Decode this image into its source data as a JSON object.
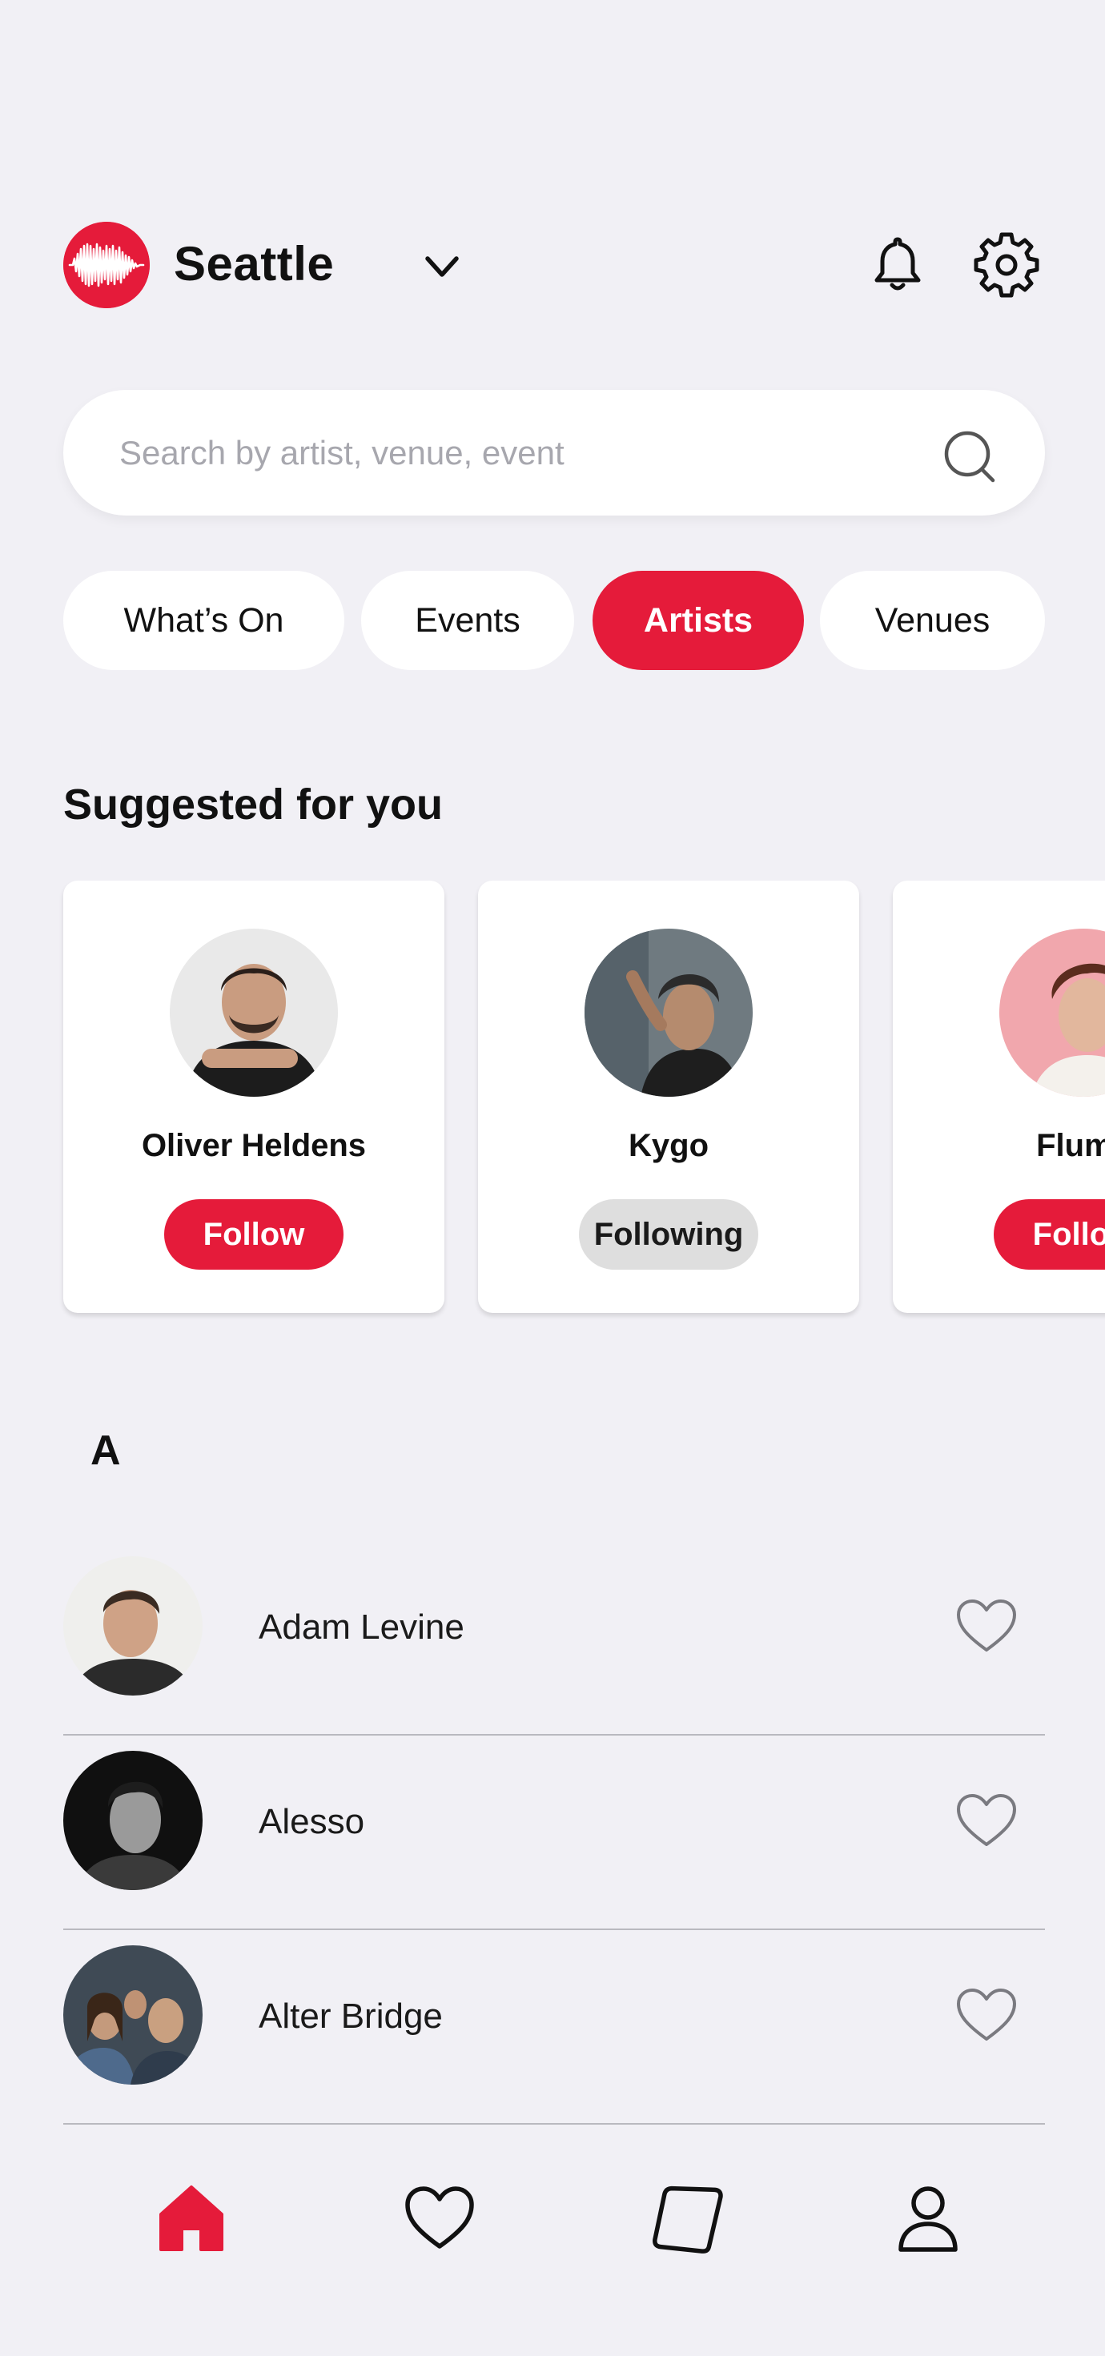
{
  "header": {
    "city": "Seattle",
    "logo_icon": "soundwave-logo-icon",
    "notification_icon": "bell-icon",
    "settings_icon": "gear-icon"
  },
  "search": {
    "placeholder": "Search by artist, venue, event",
    "value": "",
    "icon": "search-icon"
  },
  "tabs": [
    {
      "label": "What’s On",
      "active": false
    },
    {
      "label": "Events",
      "active": false
    },
    {
      "label": "Artists",
      "active": true
    },
    {
      "label": "Venues",
      "active": false
    }
  ],
  "suggested": {
    "title": "Suggested for you",
    "cards": [
      {
        "name": "Oliver Heldens",
        "button": "Follow",
        "state": "follow"
      },
      {
        "name": "Kygo",
        "button": "Following",
        "state": "following"
      },
      {
        "name": "Flume",
        "button": "Follow",
        "state": "follow"
      }
    ]
  },
  "artist_list": {
    "letter": "A",
    "rows": [
      {
        "name": "Adam Levine",
        "favorited": false
      },
      {
        "name": "Alesso",
        "favorited": false
      },
      {
        "name": "Alter Bridge",
        "favorited": false
      }
    ]
  },
  "bottom_nav": [
    {
      "name": "home",
      "icon": "home-icon",
      "active": true
    },
    {
      "name": "favorites",
      "icon": "heart-icon",
      "active": false
    },
    {
      "name": "tickets",
      "icon": "ticket-icon",
      "active": false
    },
    {
      "name": "profile",
      "icon": "user-icon",
      "active": false
    }
  ],
  "colors": {
    "accent": "#e51b3a",
    "background": "#f1f0f5",
    "surface": "#ffffff",
    "following_bg": "#dedede"
  }
}
